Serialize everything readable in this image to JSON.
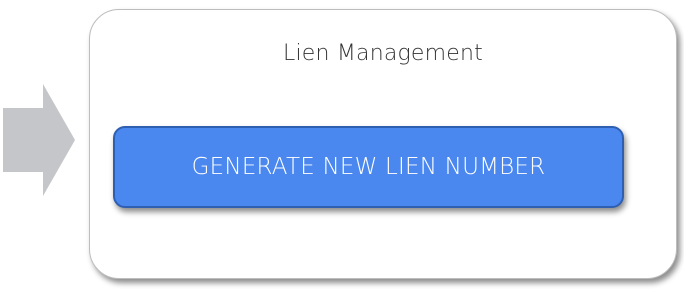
{
  "panel": {
    "title": "Lien Management"
  },
  "actions": {
    "generate_label": "GENERATE NEW LIEN NUMBER"
  },
  "icons": {
    "flow_arrow": "right-arrow-icon"
  },
  "colors": {
    "button_fill": "#4a87ee",
    "button_border": "#2f5fb0",
    "arrow_fill": "#c4c6c9",
    "panel_border": "#bdbdbd"
  }
}
